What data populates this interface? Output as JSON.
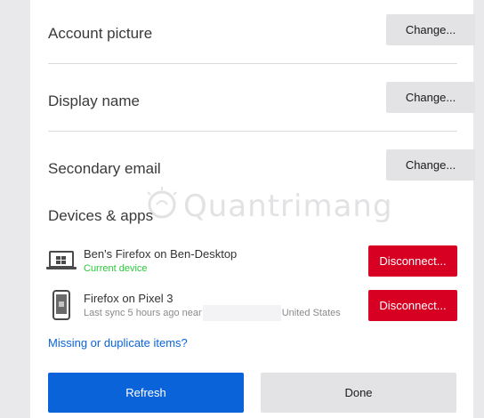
{
  "account_picture": {
    "label": "Account picture",
    "button": "Change..."
  },
  "display_name": {
    "label": "Display name",
    "button": "Change..."
  },
  "secondary_email": {
    "label": "Secondary email",
    "button": "Change..."
  },
  "devices": {
    "heading": "Devices & apps",
    "items": [
      {
        "name": "Ben's Firefox on Ben-Desktop",
        "status": "Current device",
        "icon": "laptop-icon",
        "button": "Disconnect..."
      },
      {
        "name": "Firefox on Pixel 3",
        "status_prefix": "Last sync 5 hours ago near",
        "status_suffix": "United States",
        "icon": "phone-icon",
        "button": "Disconnect..."
      }
    ]
  },
  "missing_link": "Missing or duplicate items?",
  "buttons": {
    "refresh": "Refresh",
    "done": "Done"
  },
  "watermark": "Quantrimang",
  "colors": {
    "primary": "#0a63d8",
    "danger": "#d70022",
    "current_device": "#2ac93a"
  }
}
